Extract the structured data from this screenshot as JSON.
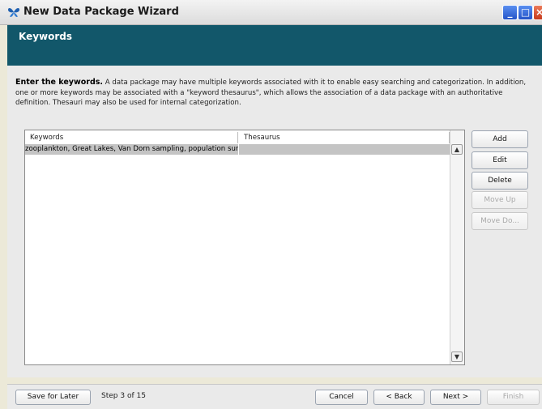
{
  "window": {
    "title": "New Data Package Wizard",
    "icon": "morpho-butterfly-icon",
    "controls": [
      "minimize",
      "maximize",
      "close"
    ]
  },
  "header": {
    "title": "Keywords",
    "band_color": "#12576a"
  },
  "instructions": {
    "bold": "Enter the keywords.",
    "text": " A data package may have multiple keywords associated with it to enable easy searching and categorization. In addition, one or more keywords may be associated with a \"keyword thesaurus\", which allows the association of a data package with an authoritative definition. Thesauri may also be used for internal categorization."
  },
  "table": {
    "columns": [
      "Keywords",
      "Thesaurus"
    ],
    "rows": [
      {
        "keywords": "zooplankton, Great Lakes, Van Dorn sampling, population survey",
        "thesaurus": ""
      }
    ]
  },
  "side_buttons": {
    "add": "Add",
    "edit": "Edit",
    "delete": "Delete",
    "move_up": "Move Up",
    "move_down": "Move Do..."
  },
  "footer": {
    "save_for_later": "Save for Later",
    "step": "Step 3 of 15",
    "cancel": "Cancel",
    "back": "< Back",
    "next": "Next >",
    "finish": "Finish"
  }
}
